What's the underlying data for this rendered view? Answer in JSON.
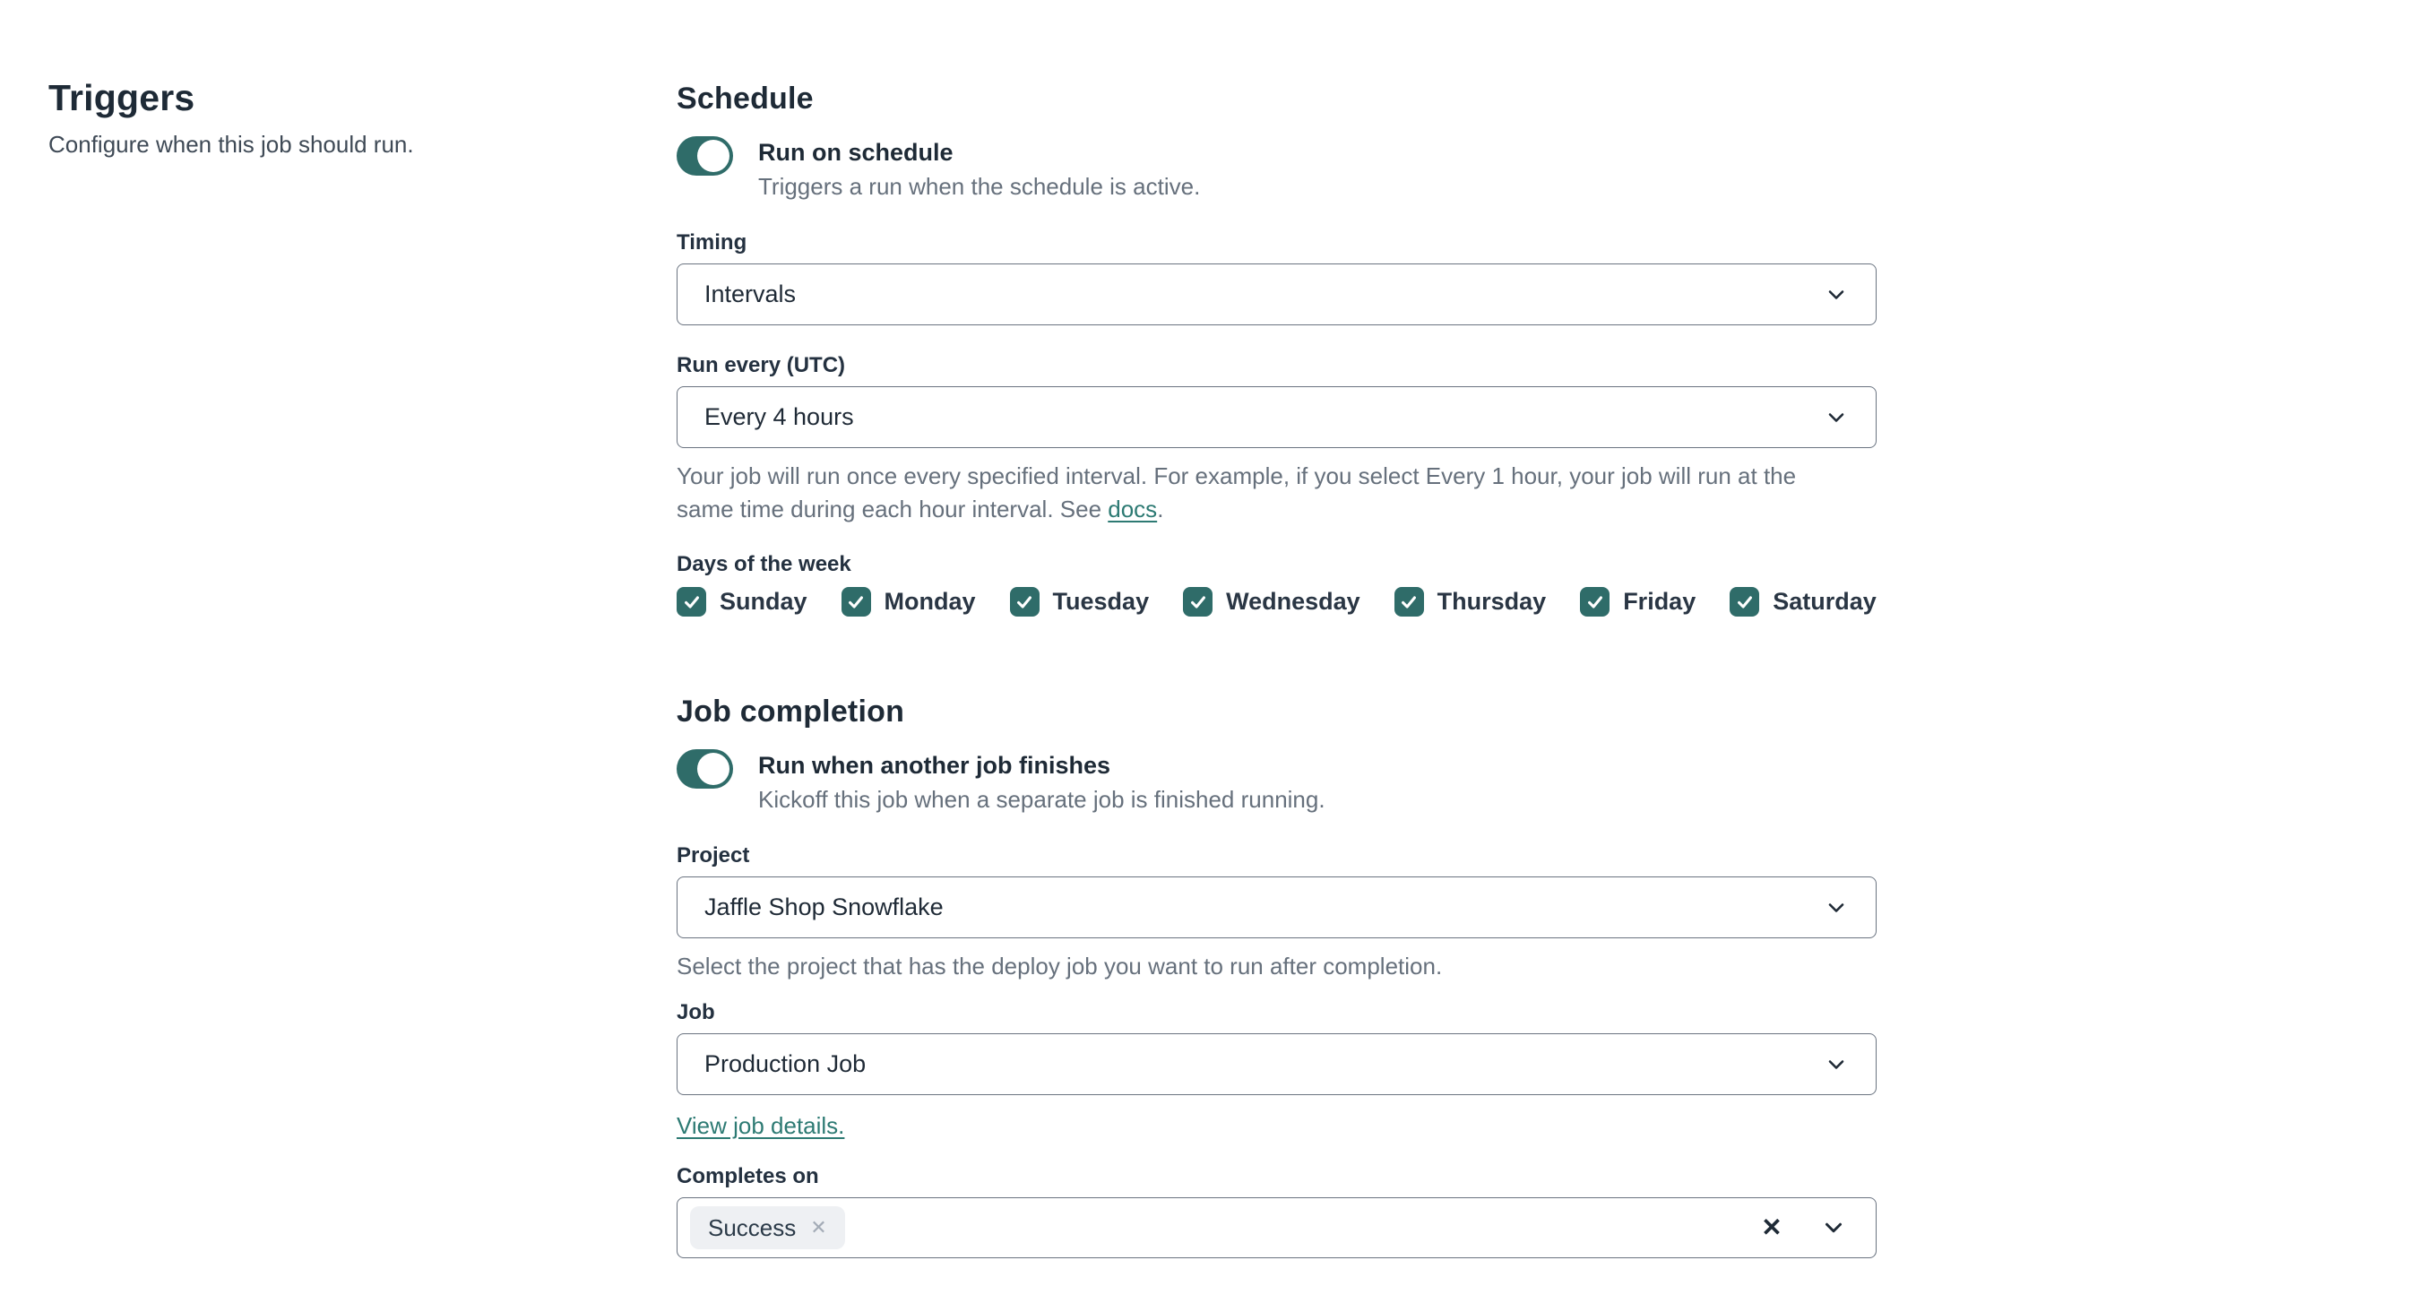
{
  "colors": {
    "accent_teal": "#2f6c69",
    "link_teal": "#2d7a73",
    "heading_text": "#1e2a36",
    "secondary_text": "#66707c",
    "input_border": "#6a7380",
    "tag_background": "#eef0f3"
  },
  "left_panel": {
    "title": "Triggers",
    "subtitle": "Configure when this job should run."
  },
  "schedule": {
    "heading": "Schedule",
    "toggle": {
      "state": "on",
      "label": "Run on schedule",
      "description": "Triggers a run when the schedule is active."
    },
    "timing": {
      "label": "Timing",
      "value": "Intervals"
    },
    "run_every": {
      "label": "Run every (UTC)",
      "value": "Every 4 hours",
      "help_before_link": "Your job will run once every specified interval. For example, if you select Every 1 hour, your job will run at the same time during each hour interval. See ",
      "help_link": "docs",
      "help_after_link": "."
    },
    "days": {
      "label": "Days of the week",
      "items": [
        {
          "label": "Sunday",
          "checked": true
        },
        {
          "label": "Monday",
          "checked": true
        },
        {
          "label": "Tuesday",
          "checked": true
        },
        {
          "label": "Wednesday",
          "checked": true
        },
        {
          "label": "Thursday",
          "checked": true
        },
        {
          "label": "Friday",
          "checked": true
        },
        {
          "label": "Saturday",
          "checked": true
        }
      ]
    }
  },
  "job_completion": {
    "heading": "Job completion",
    "toggle": {
      "state": "on",
      "label": "Run when another job finishes",
      "description": "Kickoff this job when a separate job is finished running."
    },
    "project": {
      "label": "Project",
      "value": "Jaffle Shop Snowflake",
      "help": "Select the project that has the deploy job you want to run after completion."
    },
    "job": {
      "label": "Job",
      "value": "Production Job",
      "details_link": "View job details."
    },
    "completes_on": {
      "label": "Completes on",
      "tags": [
        {
          "label": "Success"
        }
      ]
    }
  }
}
